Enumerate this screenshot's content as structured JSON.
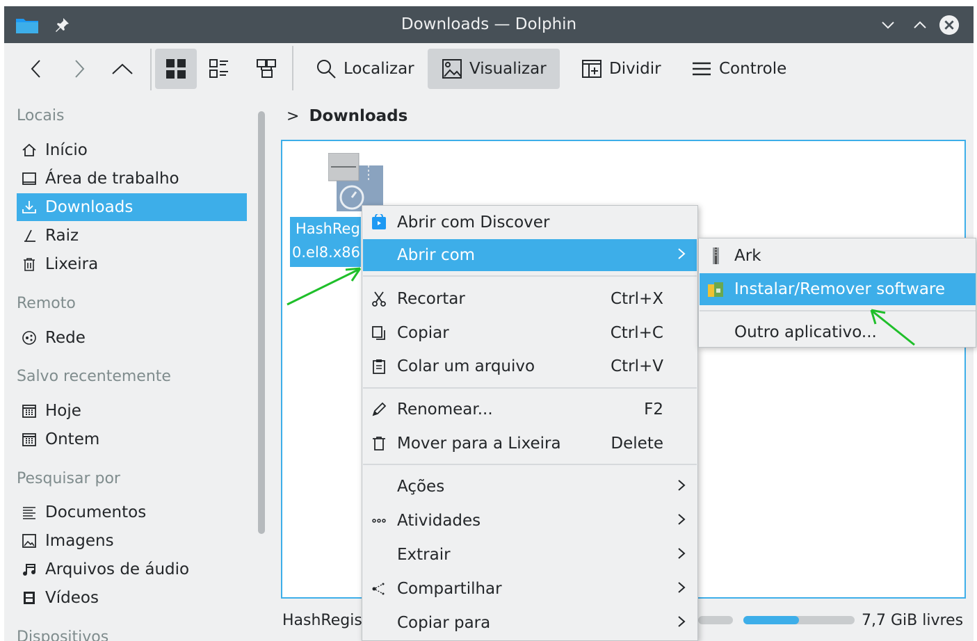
{
  "window": {
    "title": "Downloads — Dolphin"
  },
  "toolbar": {
    "find_label": "Localizar",
    "preview_label": "Visualizar",
    "split_label": "Dividir",
    "control_label": "Controle"
  },
  "sidebar": {
    "sections": {
      "places": "Locais",
      "remote": "Remoto",
      "recent": "Salvo recentemente",
      "search": "Pesquisar por",
      "devices": "Dispositivos"
    },
    "places": [
      {
        "label": "Início",
        "icon": "home-icon"
      },
      {
        "label": "Área de trabalho",
        "icon": "desktop-icon"
      },
      {
        "label": "Downloads",
        "icon": "downloads-icon",
        "selected": true
      },
      {
        "label": "Raiz",
        "icon": "root-icon"
      },
      {
        "label": "Lixeira",
        "icon": "trash-icon"
      }
    ],
    "remote": [
      {
        "label": "Rede",
        "icon": "network-icon"
      }
    ],
    "recent": [
      {
        "label": "Hoje",
        "icon": "calendar-icon"
      },
      {
        "label": "Ontem",
        "icon": "calendar-icon"
      }
    ],
    "search": [
      {
        "label": "Documentos",
        "icon": "documents-icon"
      },
      {
        "label": "Imagens",
        "icon": "images-icon"
      },
      {
        "label": "Arquivos de áudio",
        "icon": "audio-icon"
      },
      {
        "label": "Vídeos",
        "icon": "video-icon"
      }
    ]
  },
  "breadcrumb": {
    "separator": ">",
    "current": "Downloads"
  },
  "file": {
    "name_line1": "HashReg",
    "name_line2": "0.el8.x86"
  },
  "status": {
    "text": "HashRegis",
    "free_space": "7,7 GiB livres",
    "used_fraction": 0.5
  },
  "context_menu": {
    "open_discover": "Abrir com Discover",
    "open_with": "Abrir com",
    "cut": "Recortar",
    "cut_shortcut": "Ctrl+X",
    "copy": "Copiar",
    "copy_shortcut": "Ctrl+C",
    "paste": "Colar um arquivo",
    "paste_shortcut": "Ctrl+V",
    "rename": "Renomear...",
    "rename_shortcut": "F2",
    "trash": "Mover para a Lixeira",
    "trash_shortcut": "Delete",
    "actions": "Ações",
    "activities": "Atividades",
    "extract": "Extrair",
    "share": "Compartilhar",
    "copy_to": "Copiar para"
  },
  "submenu": {
    "ark": "Ark",
    "install_remove": "Instalar/Remover software",
    "other_app": "Outro aplicativo..."
  },
  "colors": {
    "accent": "#3daee9",
    "titlebar": "#475057",
    "annotation_arrow": "#1fbf2a"
  }
}
